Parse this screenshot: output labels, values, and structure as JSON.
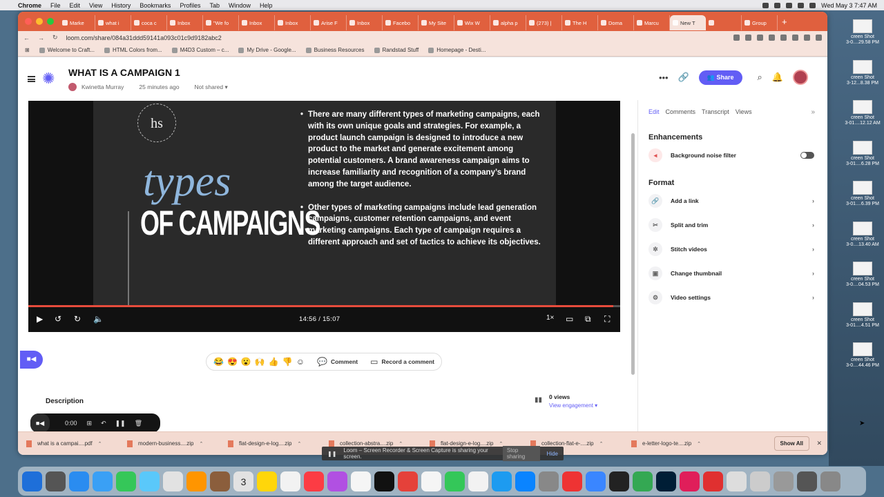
{
  "menubar": {
    "app": "Chrome",
    "items": [
      "File",
      "Edit",
      "View",
      "History",
      "Bookmarks",
      "Profiles",
      "Tab",
      "Window",
      "Help"
    ],
    "datetime": "Wed May 3  7:47 AM"
  },
  "browser": {
    "tabs": [
      "Marke",
      "what i",
      "coca c",
      "Inbox",
      "\"We fo",
      "Inbox",
      "Inbox",
      "Arise F",
      "Inbox",
      "Facebo",
      "My Site",
      "Wix W",
      "alpha p",
      "(273) |",
      "The H",
      "Doma",
      "Marcu",
      "New T",
      "",
      "Group"
    ],
    "url": "loom.com/share/084a31ddd59141a093c01c9d9182abc2",
    "bookmarks": [
      "Welcome to Craft...",
      "HTML Colors from...",
      "M4D3 Custom – c...",
      "My Drive - Google...",
      "Business Resources",
      "Randstad Stuff",
      "Homepage - Desti..."
    ]
  },
  "loom": {
    "title": "WHAT IS A CAMPAIGN 1",
    "author": "Kwinetta Murray",
    "time_ago": "25 minutes ago",
    "sharing": "Not shared",
    "share_label": "Share",
    "slide": {
      "logo_text": "hs",
      "title_line1": "types",
      "title_line2": "OF CAMPAIGNS",
      "bullets": [
        "There are many different types of marketing campaigns, each with its own unique goals and strategies. For example, a product launch campaign is designed to introduce a new product to the market and generate excitement among potential customers. A brand awareness campaign aims to increase familiarity and recognition of a company’s brand among the target audience.",
        "Other types of marketing campaigns include lead generation campaigns, customer retention campaigns, and event marketing campaigns. Each type of campaign requires a different approach and set of tactics to achieve its objectives."
      ]
    },
    "player": {
      "time": "14:56  /  15:07",
      "speed": "1×",
      "progress": 0.988
    },
    "reactions": [
      "😂",
      "😍",
      "😮",
      "🙌",
      "👍",
      "👎"
    ],
    "comment_label": "Comment",
    "record_comment_label": "Record a comment",
    "description_label": "Description",
    "views": "0 views",
    "engagement": "View engagement",
    "rec_time": "0:00",
    "panel": {
      "tabs": [
        "Edit",
        "Comments",
        "Transcript",
        "Views"
      ],
      "enhancements_title": "Enhancements",
      "noise_filter": "Background noise filter",
      "format_title": "Format",
      "format_items": [
        "Add a link",
        "Split and trim",
        "Stitch videos",
        "Change thumbnail",
        "Video settings"
      ]
    }
  },
  "downloads": {
    "items": [
      "what is a campai....pdf",
      "modern-business....zip",
      "flat-design-e-log....zip",
      "collection-abstra....zip",
      "flat-design-e-log....zip",
      "collection-flat-e-....zip",
      "e-letter-logo-te....zip"
    ],
    "show_all": "Show All"
  },
  "banner": {
    "text": "Loom – Screen Recorder & Screen Capture is sharing your screen.",
    "stop": "Stop sharing",
    "hide": "Hide"
  },
  "desktop_files": [
    {
      "name": "creen Shot",
      "sub": "3-0....29.58 PM"
    },
    {
      "name": "creen Shot",
      "sub": "3-12...8.38 PM"
    },
    {
      "name": "creen Shot",
      "sub": "3-01....12.12 AM"
    },
    {
      "name": "creen Shot",
      "sub": "3-01....6.28 PM"
    },
    {
      "name": "creen Shot",
      "sub": "3-01....6.39 PM"
    },
    {
      "name": "creen Shot",
      "sub": "3-0....13.40 AM"
    },
    {
      "name": "creen Shot",
      "sub": "3-0....04.53 PM"
    },
    {
      "name": "creen Shot",
      "sub": "3-01....4.51 PM"
    },
    {
      "name": "creen Shot",
      "sub": "3-0....44.46 PM"
    }
  ],
  "dock_badges": {
    "calendar_day": "3"
  }
}
